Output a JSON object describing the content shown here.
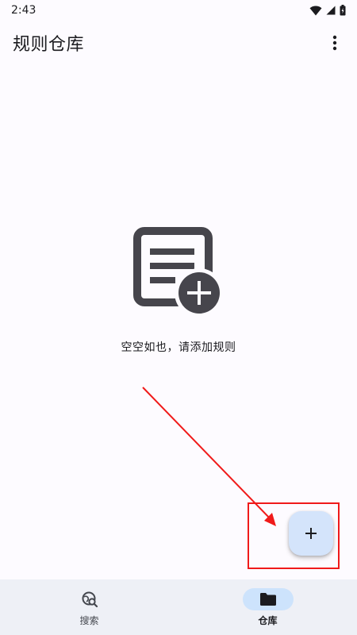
{
  "status_bar": {
    "time": "2:43",
    "icons": [
      "wifi-icon",
      "cell-signal-icon",
      "battery-icon"
    ]
  },
  "app_bar": {
    "title": "规则仓库",
    "menu_icon": "more-vert-icon"
  },
  "empty_state": {
    "icon": "add-document-icon",
    "message": "空空如也，请添加规则"
  },
  "fab": {
    "icon": "plus-icon"
  },
  "bottom_nav": {
    "items": [
      {
        "label": "搜索",
        "icon": "search-globe-icon",
        "active": false
      },
      {
        "label": "仓库",
        "icon": "folder-icon",
        "active": true
      }
    ]
  },
  "colors": {
    "background": "#fdfbff",
    "fab": "#d4e4fb",
    "nav_background": "#eef0f6",
    "nav_active_pill": "#cde3fc",
    "annotation": "#f01a1a",
    "icon_dark": "#46454c"
  }
}
